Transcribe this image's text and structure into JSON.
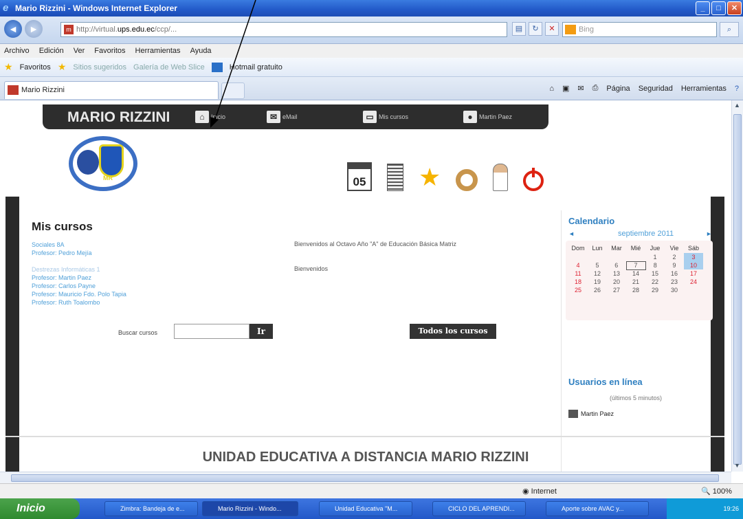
{
  "window": {
    "title": "Mario Rizzini - Windows Internet Explorer"
  },
  "address": {
    "url_prefix": "http://virtual.",
    "url_domain": "ups.edu.ec",
    "url_suffix": "/ccp/...",
    "search_placeholder": "Bing"
  },
  "menu": [
    "Archivo",
    "Edición",
    "Ver",
    "Favoritos",
    "Herramientas",
    "Ayuda"
  ],
  "favorites": {
    "label": "Favoritos",
    "item1": "Sitios sugeridos",
    "item2": "Galería de Web Slice",
    "item3": "Hotmail gratuito"
  },
  "tab": {
    "title": "Mario Rizzini"
  },
  "commandbar": {
    "pagina": "Página",
    "seguridad": "Seguridad",
    "herramientas": "Herramientas"
  },
  "site": {
    "brand": "MARIO RIZZINI",
    "nav": {
      "inicio": "Inicio",
      "email": "eMail",
      "cursos": "Mis cursos",
      "usuario": "Martin Paez"
    },
    "calendar_icon": "05"
  },
  "courses": {
    "title": "Mis cursos",
    "list": [
      {
        "name": "Sociales 8A",
        "teachers": [
          "Profesor: Pedro Mejía"
        ],
        "desc": "Bienvenidos al Octavo Año \"A\" de Educación Básica Matriz"
      },
      {
        "name": "Destrezas Informáticas 1",
        "teachers": [
          "Profesor: Martin Paez",
          "Profesor: Carlos Payne",
          "Profesor: Mauricio Fdo. Polo Tapia",
          "Profesor: Ruth Toalombo"
        ],
        "desc": "Bienvenidos"
      }
    ],
    "search_label": "Buscar cursos",
    "go_label": "Ir",
    "all_label": "Todos los cursos"
  },
  "calendar": {
    "title": "Calendario",
    "month": "septiembre 2011",
    "days": [
      "Dom",
      "Lun",
      "Mar",
      "Mié",
      "Jue",
      "Vie",
      "Sáb"
    ],
    "weeks": [
      [
        "",
        "",
        "",
        "",
        "1",
        "2",
        "3"
      ],
      [
        "4",
        "5",
        "6",
        "7",
        "8",
        "9",
        "10"
      ],
      [
        "11",
        "12",
        "13",
        "14",
        "15",
        "16",
        "17"
      ],
      [
        "18",
        "19",
        "20",
        "21",
        "22",
        "23",
        "24"
      ],
      [
        "25",
        "26",
        "27",
        "28",
        "29",
        "30",
        ""
      ]
    ],
    "today": "7",
    "highlighted": [
      "3",
      "10"
    ]
  },
  "online": {
    "title": "Usuarios en línea",
    "subtitle": "(últimos 5 minutos)",
    "user": "Martin Paez"
  },
  "footer": {
    "title": "UNIDAD EDUCATIVA A DISTANCIA MARIO RIZZINI"
  },
  "status": {
    "zone": "Internet",
    "zoom": "100%"
  },
  "taskbar": {
    "start": "Inicio",
    "items": [
      "Zimbra: Bandeja de e...",
      "Mario Rizzini - Windo...",
      "Unidad Educativa \"M...",
      "CICLO DEL APRENDI...",
      "Aporte sobre AVAC y..."
    ],
    "clock": "19:26"
  }
}
